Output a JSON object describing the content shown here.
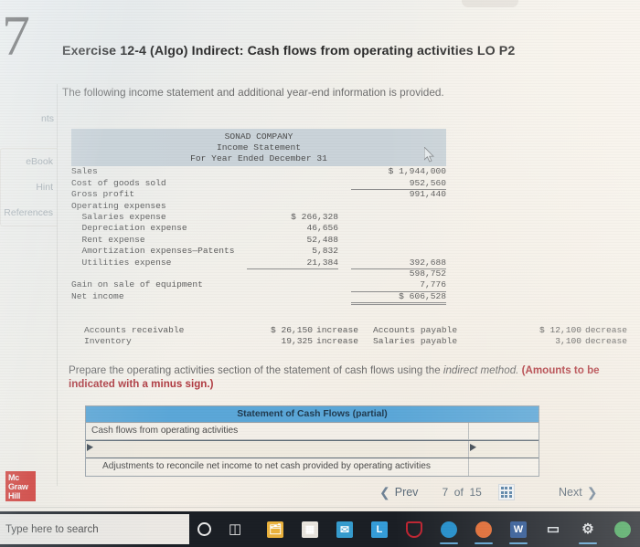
{
  "question_number": "7",
  "rail": {
    "points_label": "nts",
    "items": [
      {
        "label": "eBook"
      },
      {
        "label": "Hint"
      },
      {
        "label": "References"
      }
    ]
  },
  "exercise": {
    "title": "Exercise 12-4 (Algo) Indirect: Cash flows from operating activities LO P2",
    "intro": "The following income statement and additional year-end information is provided."
  },
  "income_statement": {
    "company": "SONAD COMPANY",
    "statement": "Income Statement",
    "period": "For Year Ended December 31",
    "rows": [
      {
        "label": "Sales",
        "c1": "",
        "c2": "$ 1,944,000"
      },
      {
        "label": "Cost of goods sold",
        "c1": "",
        "c2": "952,560"
      },
      {
        "label": "Gross profit",
        "c1": "",
        "c2": "991,440"
      },
      {
        "label": "Operating expenses",
        "c1": "",
        "c2": ""
      },
      {
        "label": "  Salaries expense",
        "c1": "$ 266,328",
        "c2": ""
      },
      {
        "label": "  Depreciation expense",
        "c1": "46,656",
        "c2": ""
      },
      {
        "label": "  Rent expense",
        "c1": "52,488",
        "c2": ""
      },
      {
        "label": "  Amortization expenses—Patents",
        "c1": "5,832",
        "c2": ""
      },
      {
        "label": "  Utilities expense",
        "c1": "21,384",
        "c2": "392,688"
      },
      {
        "label": "",
        "c1": "",
        "c2": "598,752"
      },
      {
        "label": "Gain on sale of equipment",
        "c1": "",
        "c2": "7,776"
      },
      {
        "label": "Net income",
        "c1": "",
        "c2": "$ 606,528"
      }
    ]
  },
  "additional_info": [
    {
      "left_label": "Accounts receivable",
      "left_value": "$ 26,150",
      "left_change": "increase",
      "right_label": "Accounts payable",
      "right_value": "$ 12,100",
      "right_change": "decrease"
    },
    {
      "left_label": "Inventory",
      "left_value": "19,325",
      "left_change": "increase",
      "right_label": "Salaries payable",
      "right_value": "3,100",
      "right_change": "decrease"
    }
  ],
  "instruction": {
    "part1": "Prepare the operating activities section of the statement of cash flows using the ",
    "italic": "indirect method.",
    "part2": " (Amounts to be",
    "part3": "indicated with a minus sign.)"
  },
  "cash_flow_table": {
    "header": "Statement of Cash Flows (partial)",
    "rows": [
      {
        "label": "Cash flows from operating activities",
        "value": "",
        "indent": false,
        "editing": false
      },
      {
        "label": "",
        "value": "",
        "indent": false,
        "editing": true
      },
      {
        "label": "Adjustments to reconcile net income to net cash provided by operating activities",
        "value": "",
        "indent": true,
        "editing": false
      }
    ]
  },
  "logo": {
    "line1": "Mc",
    "line2": "Graw",
    "line3": "Hill"
  },
  "nav": {
    "prev_label": "Prev",
    "prev_icon": "chevron-left-icon",
    "page_indicator": "7  of  15",
    "grid_icon": "grid-menu-icon",
    "next_label": "Next",
    "next_icon": "chevron-right-icon"
  },
  "taskbar": {
    "search_placeholder": "Type here to search",
    "cortana_icon": "cortana-circle-icon",
    "taskview_icon": "task-view-icon",
    "apps": [
      {
        "name": "file-explorer-icon",
        "color": "#f0b232",
        "glyph": "🗂"
      },
      {
        "name": "microsoft-store-icon",
        "color": "#e8e4dc",
        "glyph": "▦"
      },
      {
        "name": "mail-icon",
        "color": "#2f9ed4",
        "glyph": "✉"
      },
      {
        "name": "lastpass-icon",
        "color": "#2e9fe0",
        "glyph": "L"
      },
      {
        "name": "mcafee-shield-icon",
        "color": "#c8202e",
        "glyph": "⬟"
      },
      {
        "name": "microsoft-edge-icon",
        "color": "#1a8fd1",
        "glyph": "●"
      },
      {
        "name": "firefox-icon",
        "color": "#e8682c",
        "glyph": "●"
      },
      {
        "name": "microsoft-word-icon",
        "color": "#2b579a",
        "glyph": "W"
      },
      {
        "name": "onenote-icon",
        "color": "#d8dde2",
        "glyph": "▭"
      },
      {
        "name": "settings-gear-icon",
        "color": "#d9dde1",
        "glyph": "⚙"
      },
      {
        "name": "google-chrome-icon",
        "color": "#3fa757",
        "glyph": "●"
      }
    ]
  },
  "cursor": {
    "name": "mouse-pointer"
  },
  "colors": {
    "accent_blue": "#56a8dd",
    "brand_red": "#e0342c",
    "statement_header_band": "#c9d3da",
    "page_background": "#f7f3ec",
    "taskbar": "#1b1f26"
  }
}
